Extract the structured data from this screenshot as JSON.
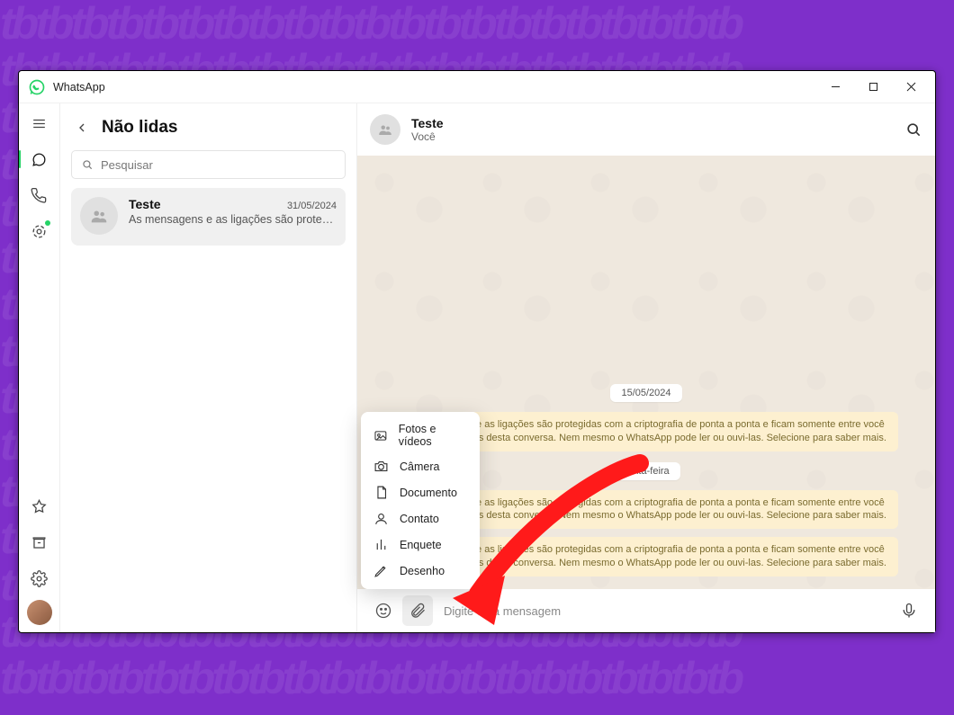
{
  "window": {
    "title": "WhatsApp"
  },
  "rail": {
    "items": [
      "menu",
      "chats",
      "calls",
      "status",
      "favorites",
      "archive",
      "settings"
    ]
  },
  "sidebar": {
    "title": "Não lidas",
    "search_placeholder": "Pesquisar",
    "chats": [
      {
        "name": "Teste",
        "date": "31/05/2024",
        "preview": "As mensagens e as ligações são protegi..."
      }
    ]
  },
  "conversation": {
    "header": {
      "name": "Teste",
      "subtitle": "Você"
    },
    "date_chips": [
      "15/05/2024",
      "sexta-feira"
    ],
    "info_text": "As mensagens e as ligações são protegidas com a criptografia de ponta a ponta e ficam somente entre você e os participantes desta conversa. Nem mesmo o WhatsApp pode ler ou ouvi-las. Selecione para saber mais.",
    "composer": {
      "placeholder": "Digite uma mensagem"
    }
  },
  "attach_menu": {
    "items": [
      {
        "icon": "image",
        "label": "Fotos e vídeos"
      },
      {
        "icon": "camera",
        "label": "Câmera"
      },
      {
        "icon": "document",
        "label": "Documento"
      },
      {
        "icon": "contact",
        "label": "Contato"
      },
      {
        "icon": "poll",
        "label": "Enquete"
      },
      {
        "icon": "drawing",
        "label": "Desenho"
      }
    ]
  }
}
